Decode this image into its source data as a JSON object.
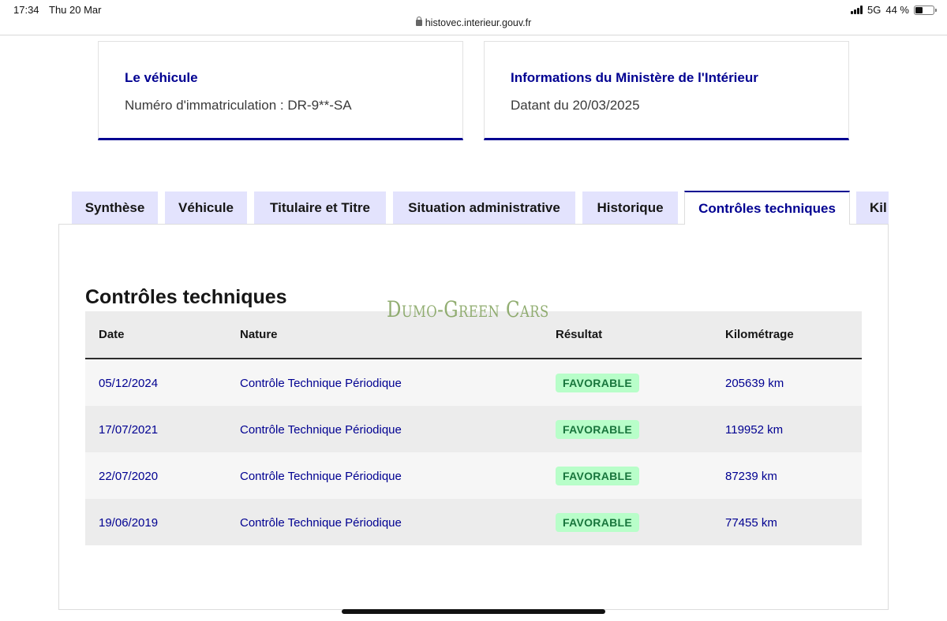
{
  "status_bar": {
    "time": "17:34",
    "date": "Thu 20 Mar",
    "network": "5G",
    "battery": "44 %",
    "battery_level": 0.44
  },
  "browser": {
    "url": "histovec.interieur.gouv.fr"
  },
  "cards": [
    {
      "title": "Le véhicule",
      "text": "Numéro d'immatriculation : DR-9**-SA"
    },
    {
      "title": "Informations du Ministère de l'Intérieur",
      "text": "Datant du 20/03/2025"
    }
  ],
  "tabs": [
    {
      "label": "Synthèse",
      "active": false
    },
    {
      "label": "Véhicule",
      "active": false
    },
    {
      "label": "Titulaire et Titre",
      "active": false
    },
    {
      "label": "Situation administrative",
      "active": false
    },
    {
      "label": "Historique",
      "active": false
    },
    {
      "label": "Contrôles techniques",
      "active": true
    },
    {
      "label": "Kil",
      "active": false
    }
  ],
  "section": {
    "title": "Contrôles techniques"
  },
  "watermark": "Dumo-Green Cars",
  "table": {
    "headers": [
      "Date",
      "Nature",
      "Résultat",
      "Kilométrage"
    ],
    "rows": [
      {
        "date": "05/12/2024",
        "nature": "Contrôle Technique Périodique",
        "result": "FAVORABLE",
        "km": "205639 km"
      },
      {
        "date": "17/07/2021",
        "nature": "Contrôle Technique Périodique",
        "result": "FAVORABLE",
        "km": "119952 km"
      },
      {
        "date": "22/07/2020",
        "nature": "Contrôle Technique Périodique",
        "result": "FAVORABLE",
        "km": "87239 km"
      },
      {
        "date": "19/06/2019",
        "nature": "Contrôle Technique Périodique",
        "result": "FAVORABLE",
        "km": "77455 km"
      }
    ]
  },
  "colors": {
    "primary": "#000091",
    "tab_inactive": "#e3e3fd",
    "badge_bg": "#b8fec9",
    "badge_text": "#18753c"
  }
}
